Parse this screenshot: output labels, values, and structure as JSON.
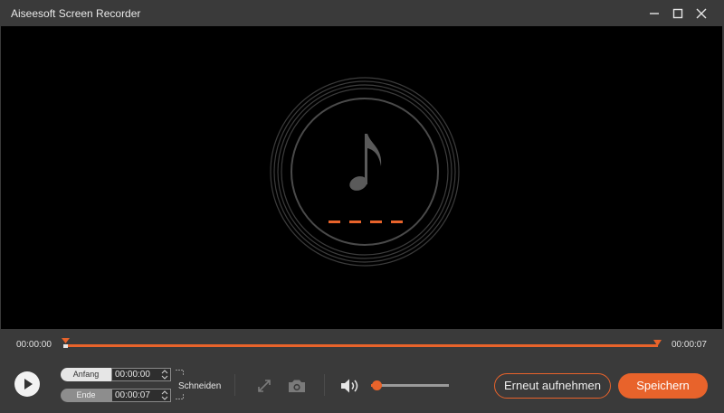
{
  "window": {
    "title": "Aiseesoft Screen Recorder"
  },
  "window_controls": [
    "minimize-icon",
    "maximize-icon",
    "close-icon"
  ],
  "preview": {
    "icon": "music-note-icon",
    "dash_count": 4
  },
  "timeline": {
    "start_time": "00:00:00",
    "end_time": "00:00:07"
  },
  "trim": {
    "start_label": "Anfang",
    "start_value": "00:00:00",
    "end_label": "Ende",
    "end_value": "00:00:07",
    "cut_label": "Schneiden"
  },
  "tools": [
    "fullscreen-icon",
    "camera-icon",
    "speaker-icon"
  ],
  "volume": {
    "level": 0.07
  },
  "buttons": {
    "rerecord": "Erneut aufnehmen",
    "save": "Speichern"
  },
  "colors": {
    "accent": "#e8632b",
    "background": "#3a3a3a",
    "preview": "#000000"
  }
}
